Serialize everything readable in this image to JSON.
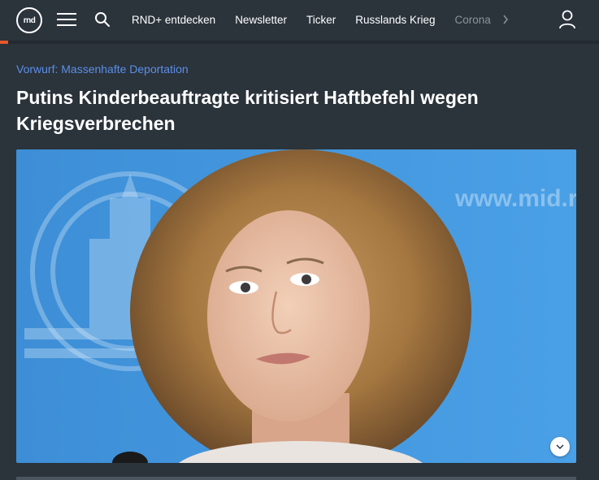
{
  "header": {
    "logo_text": "rnd",
    "menu_icon": "hamburger-menu-icon",
    "search_icon": "search-icon",
    "user_icon": "user-icon",
    "accent_color": "#e8572a",
    "nav_items": [
      {
        "label": "RND+ entdecken"
      },
      {
        "label": "Newsletter"
      },
      {
        "label": "Ticker"
      },
      {
        "label": "Russlands Krieg"
      },
      {
        "label": "Corona"
      }
    ],
    "more_icon": "chevron-right-icon"
  },
  "article": {
    "kicker": "Vorwurf: Massenhafte Deportation",
    "kicker_color": "#5b8fe8",
    "headline": "Putins Kinderbeauftragte kritisiert Haftbefehl wegen Kriegsverbrechen",
    "hero_image": {
      "backdrop_text": "www.mid.ru",
      "expand_icon": "chevron-down-icon"
    }
  }
}
